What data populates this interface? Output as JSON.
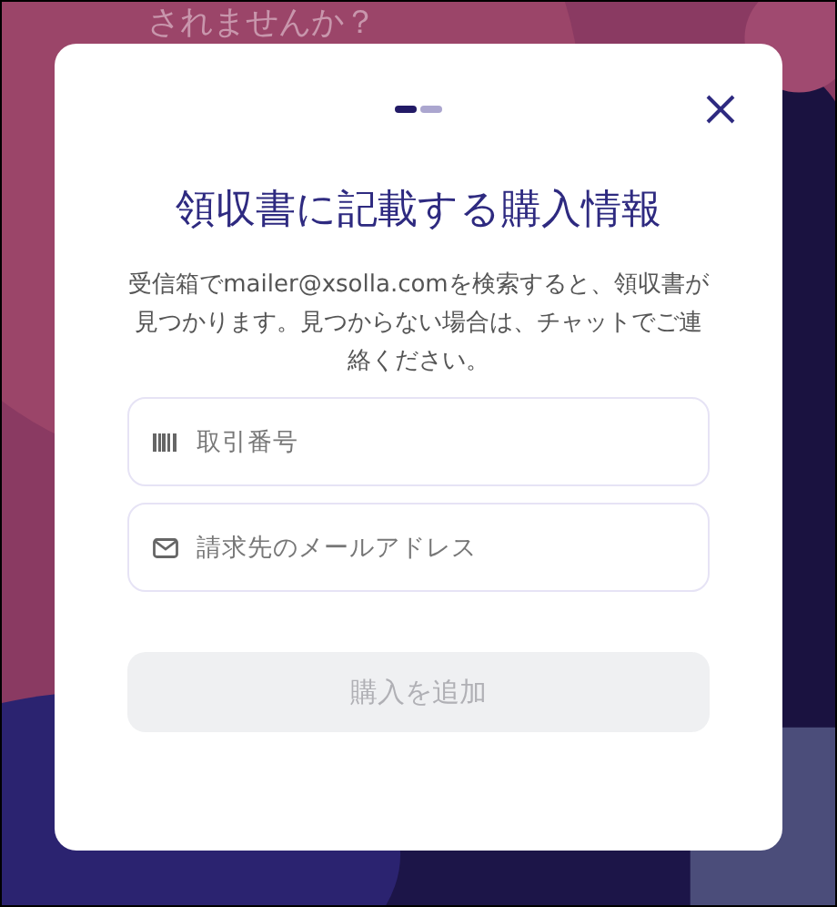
{
  "background": {
    "heading": "されませんか？"
  },
  "dialog": {
    "steps": [
      {
        "selected": true
      },
      {
        "selected": false
      }
    ],
    "title": "領収書に記載する購入情報",
    "description": "受信箱でmailer@xsolla.comを検索すると、領収書が見つかります。見つからない場合は、チャットでご連絡ください。",
    "fields": [
      {
        "kind": "barcode",
        "placeholder": "取引番号"
      },
      {
        "kind": "email",
        "placeholder": "請求先のメールアドレス"
      }
    ],
    "submit": {
      "label": "購入を追加",
      "disabled": true
    }
  }
}
